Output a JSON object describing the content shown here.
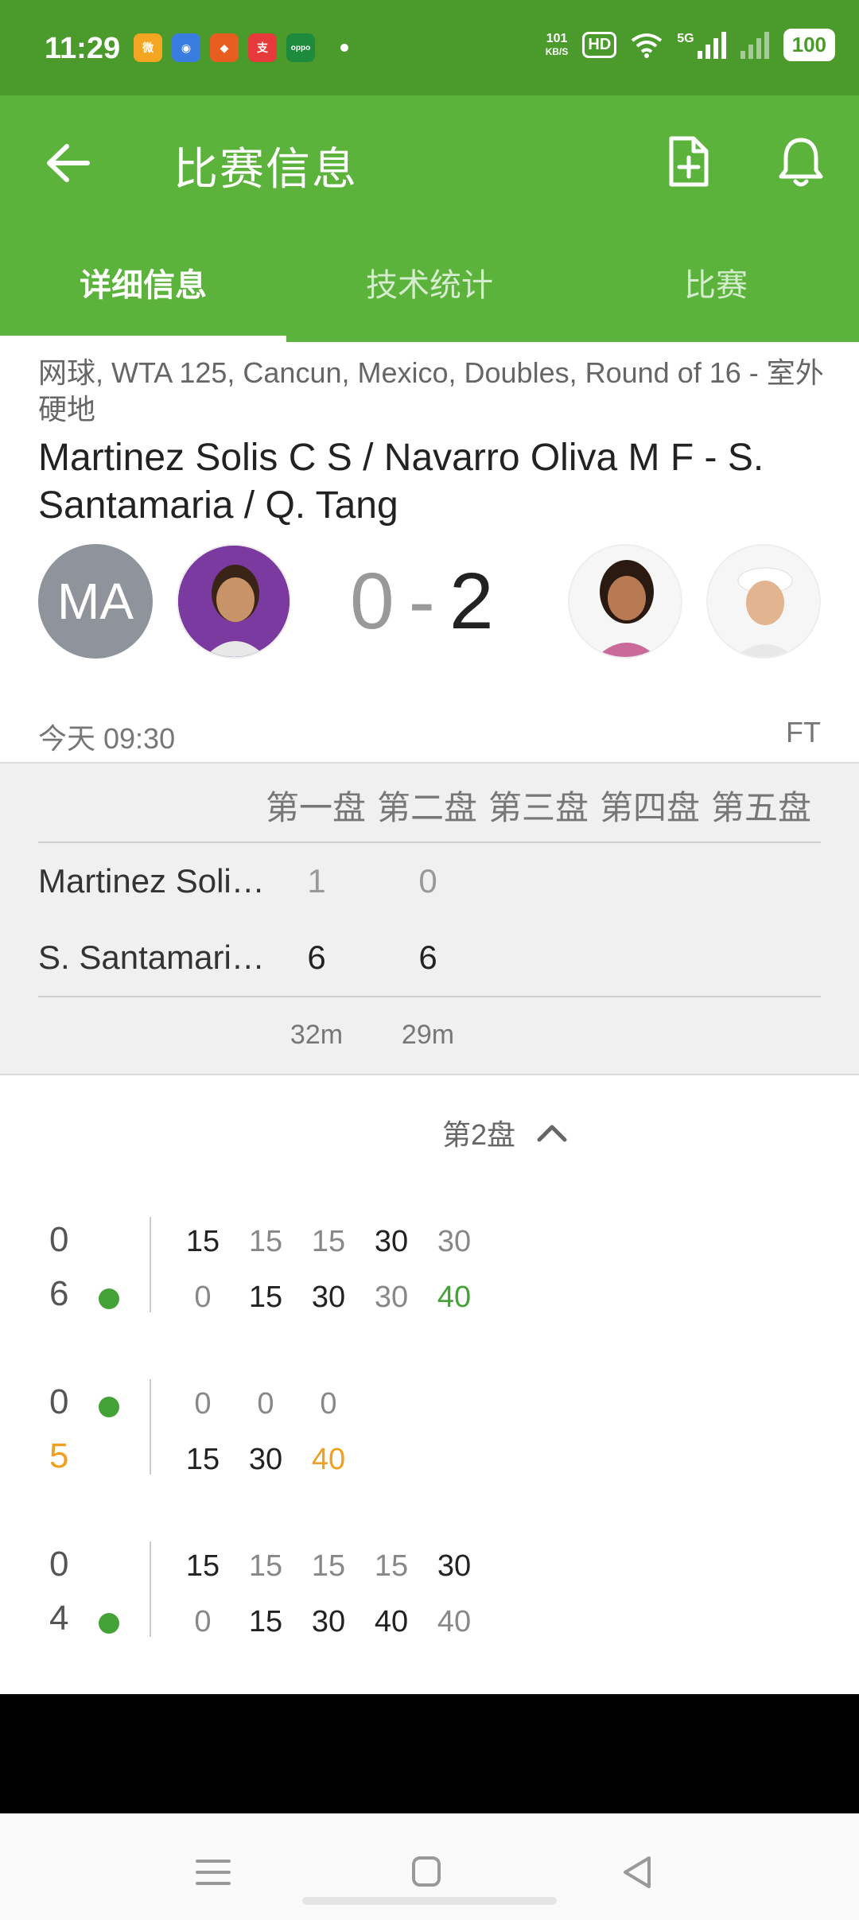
{
  "status_bar": {
    "time": "11:29",
    "apps": [
      {
        "name": "weibo",
        "color": "#f4a623",
        "glyph": "微"
      },
      {
        "name": "app-blue",
        "color": "#3a7de0",
        "glyph": "◉"
      },
      {
        "name": "app-orange",
        "color": "#e85d20",
        "glyph": "◆"
      },
      {
        "name": "alipay",
        "color": "#e83a3a",
        "glyph": "支"
      },
      {
        "name": "oppo",
        "color": "#1d8a3c",
        "glyph": "oppo"
      }
    ],
    "net_speed_value": "101",
    "net_speed_unit": "KB/S",
    "hd": "HD",
    "signal": "5G",
    "battery": "100"
  },
  "app_bar": {
    "title": "比赛信息",
    "back_icon": "arrow-left-icon",
    "doc_icon": "document-add-icon",
    "bell_icon": "bell-icon"
  },
  "tabs": [
    {
      "label": "详细信息",
      "active": true
    },
    {
      "label": "技术统计",
      "active": false
    },
    {
      "label": "比赛",
      "active": false
    }
  ],
  "match": {
    "meta": "网球, WTA 125, Cancun, Mexico, Doubles, Round of 16 - 室外硬地",
    "title": "Martinez Solis C S / Navarro Oliva M F - S. Santamaria / Q. Tang",
    "home_initials": "MA",
    "home_score": "0",
    "separator": "-",
    "away_score": "2",
    "start_time": "今天 09:30",
    "status": "FT"
  },
  "sets_table": {
    "headers": [
      "第一盘",
      "第二盘",
      "第三盘",
      "第四盘",
      "第五盘"
    ],
    "players": [
      {
        "name": "Martinez Soli…",
        "scores": [
          "1",
          "0"
        ]
      },
      {
        "name": "S. Santamari…",
        "scores": [
          "6",
          "6"
        ]
      }
    ],
    "durations": [
      "32m",
      "29m"
    ]
  },
  "set_detail": {
    "label": "第2盘",
    "toggle_icon": "chevron-up-icon",
    "games": [
      {
        "home_games": "0",
        "away_games": "6",
        "server": "away",
        "away_color": "#555555",
        "home_points": [
          {
            "v": "15",
            "c": "dark"
          },
          {
            "v": "15",
            "c": "gray"
          },
          {
            "v": "15",
            "c": "gray"
          },
          {
            "v": "30",
            "c": "dark"
          },
          {
            "v": "30",
            "c": "gray"
          }
        ],
        "away_points": [
          {
            "v": "0",
            "c": "gray"
          },
          {
            "v": "15",
            "c": "dark"
          },
          {
            "v": "30",
            "c": "dark"
          },
          {
            "v": "30",
            "c": "gray"
          },
          {
            "v": "40",
            "c": "green"
          }
        ]
      },
      {
        "home_games": "0",
        "away_games": "5",
        "server": "home",
        "away_color": "#f0a020",
        "home_points": [
          {
            "v": "0",
            "c": "gray"
          },
          {
            "v": "0",
            "c": "gray"
          },
          {
            "v": "0",
            "c": "gray"
          }
        ],
        "away_points": [
          {
            "v": "15",
            "c": "dark"
          },
          {
            "v": "30",
            "c": "dark"
          },
          {
            "v": "40",
            "c": "orange"
          }
        ]
      },
      {
        "home_games": "0",
        "away_games": "4",
        "server": "away",
        "away_color": "#555555",
        "home_points": [
          {
            "v": "15",
            "c": "dark"
          },
          {
            "v": "15",
            "c": "gray"
          },
          {
            "v": "15",
            "c": "gray"
          },
          {
            "v": "15",
            "c": "gray"
          },
          {
            "v": "30",
            "c": "dark"
          }
        ],
        "away_points": [
          {
            "v": "0",
            "c": "gray"
          },
          {
            "v": "15",
            "c": "dark"
          },
          {
            "v": "30",
            "c": "dark"
          },
          {
            "v": "40",
            "c": "dark"
          },
          {
            "v": "40",
            "c": "gray"
          }
        ]
      }
    ]
  },
  "nav_bar": {
    "menu_icon": "menu-icon",
    "home_icon": "home-square-icon",
    "back_icon": "back-triangle-icon"
  },
  "colors": {
    "primary": "#5bb33c",
    "status_bar": "#4a9a2c",
    "serve_dot": "#43a336",
    "highlight_orange": "#f0a020"
  }
}
